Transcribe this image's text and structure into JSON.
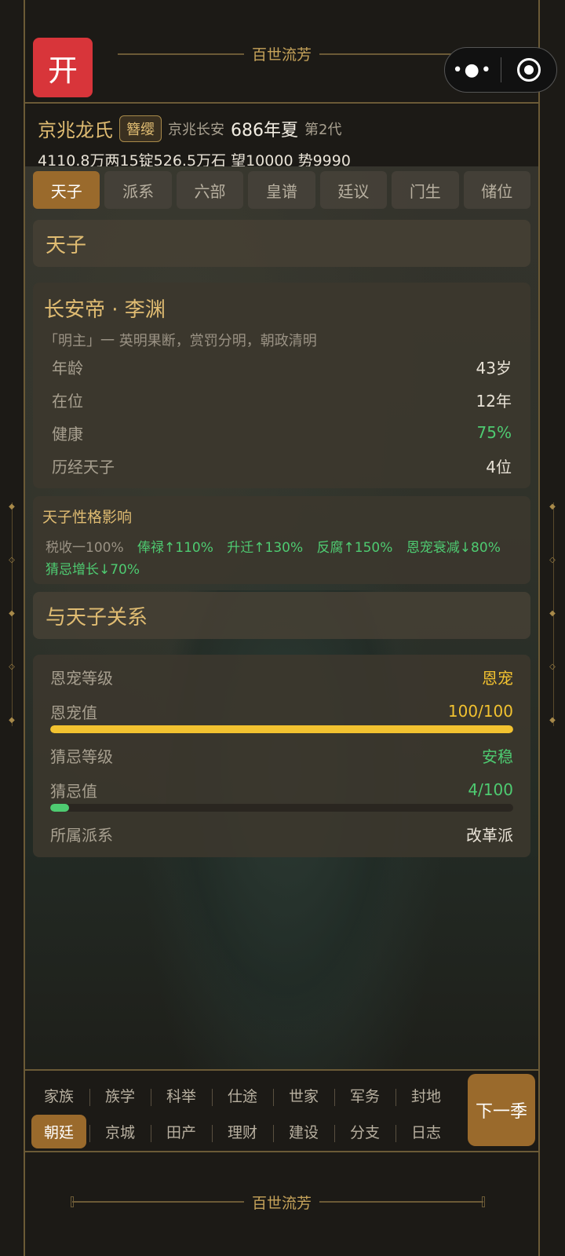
{
  "header": {
    "app_button": "开",
    "title": "百世流芳"
  },
  "clan": {
    "name": "京兆龙氏",
    "rank": "簪缨",
    "location": "京兆长安",
    "year": "686年夏",
    "generation": "第2代",
    "stats": "4110.8万两15锭526.5万石  望10000  势9990"
  },
  "tabs": [
    {
      "label": "天子",
      "active": true
    },
    {
      "label": "派系",
      "active": false
    },
    {
      "label": "六部",
      "active": false
    },
    {
      "label": "皇谱",
      "active": false
    },
    {
      "label": "廷议",
      "active": false
    },
    {
      "label": "门生",
      "active": false
    },
    {
      "label": "储位",
      "active": false
    }
  ],
  "emperor_section": {
    "title": "天子"
  },
  "emperor": {
    "name": "长安帝 · 李渊",
    "desc": "「明主」一 英明果断，赏罚分明，朝政清明",
    "rows": [
      {
        "label": "年龄",
        "value": "43岁"
      },
      {
        "label": "在位",
        "value": "12年"
      },
      {
        "label": "健康",
        "value": "75%"
      },
      {
        "label": "历经天子",
        "value": "4位"
      }
    ]
  },
  "effects": {
    "title": "天子性格影响",
    "items": [
      "税收一100%",
      "俸禄↑110%",
      "升迁↑130%",
      "反腐↑150%",
      "恩宠衰减↓80%",
      "猜忌增长↓70%"
    ]
  },
  "relation_section": {
    "title": "与天子关系"
  },
  "relation": {
    "favor_level_label": "恩宠等级",
    "favor_level": "恩宠",
    "favor_value_label": "恩宠值",
    "favor_value": "100/100",
    "favor_fraction": 1.0,
    "suspicion_level_label": "猜忌等级",
    "suspicion_level": "安稳",
    "suspicion_value_label": "猜忌值",
    "suspicion_value": "4/100",
    "suspicion_fraction": 0.04,
    "faction_label": "所属派系",
    "faction": "改革派"
  },
  "colors": {
    "gold": "#f2c230",
    "green": "#4ecb71",
    "accent": "#9a6a2c"
  },
  "bottom_nav": {
    "row1": [
      "家族",
      "族学",
      "科举",
      "仕途",
      "世家",
      "军务",
      "封地"
    ],
    "row2": [
      "朝廷",
      "京城",
      "田产",
      "理财",
      "建设",
      "分支",
      "日志"
    ],
    "active": "朝廷",
    "next_button": "下一季"
  },
  "footer": {
    "title": "百世流芳"
  }
}
